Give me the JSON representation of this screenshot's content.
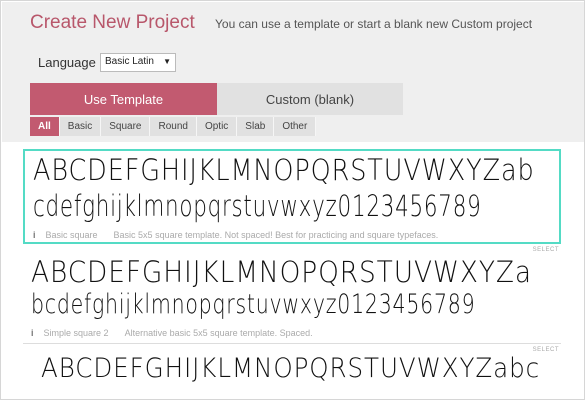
{
  "header": {
    "title": "Create New Project",
    "subtitle": "You can use a template or start a blank new Custom project"
  },
  "language": {
    "label": "Language",
    "selected": "Basic Latin",
    "arrow": "▼"
  },
  "tabs": [
    {
      "label": "Use Template",
      "active": true
    },
    {
      "label": "Custom (blank)",
      "active": false
    }
  ],
  "filters": [
    "All",
    "Basic",
    "Square",
    "Round",
    "Optic",
    "Slab",
    "Other"
  ],
  "active_filter": "All",
  "select_label": "SELECT",
  "info_icon": "i",
  "templates": [
    {
      "line1": "ABCDEFGHIJKLMNOPQRSTUVWXYZab",
      "line2": "cdefghijklmnopqrstuvwxyz0123456789",
      "name": "Basic square",
      "description": "Basic 5x5 square template. Not spaced! Best for practicing and square typefaces."
    },
    {
      "line1": "ABCDEFGHIJKLMNOPQRSTUVWXYZa",
      "line2": "bcdefghijklmnopqrstuvwxyz0123456789",
      "name": "Simple square 2",
      "description": "Alternative basic 5x5 square template. Spaced."
    },
    {
      "line1": "ABCDEFGHIJKLMNOPQRSTUVWXYZabc"
    }
  ],
  "colors": {
    "accent": "#c25a70",
    "title": "#b8576b",
    "selected_border": "#54dbc5"
  }
}
